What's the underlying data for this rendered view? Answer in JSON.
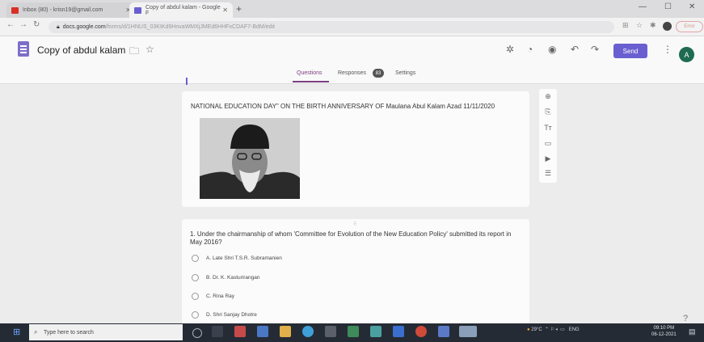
{
  "browser": {
    "tabs": [
      {
        "label": "Inbox (80) - krisn19@gmail.com",
        "favicon_color": "#d93025"
      },
      {
        "label": "Copy of abdul kalam - Google F",
        "favicon_color": "#6a5fd0"
      }
    ],
    "url_domain": "docs.google.com",
    "url_path": "/forms/d/1HNUS_03KIKd9HnvaWMXjJMEd6HHFxCDAF7-BdM/edit",
    "profile_label": "Error"
  },
  "form": {
    "doc_title": "Copy of abdul kalam",
    "send_label": "Send",
    "avatar_initial": "A",
    "tabs": {
      "questions": "Questions",
      "responses": "Responses",
      "responses_count": "83",
      "settings": "Settings"
    },
    "title": "NATIONAL EDUCATION DAY\" ON THE BIRTH ANNIVERSARY OF Maulana Abul Kalam Azad 11/11/2020",
    "question": {
      "text": "1. Under the chairmanship of whom 'Committee for Evolution of the New Education Policy' submitted its report in May 2016?",
      "options": [
        "A. Late Shri T.S.R. Subramanien",
        "B. Dr. K. Kasturirangan",
        "C. Rina Ray",
        "D. Shri Sanjay Dhotre"
      ]
    },
    "accent_color": "#6a5fd0"
  },
  "taskbar": {
    "search_placeholder": "Type here to search",
    "temperature": "29°C",
    "language": "ENG",
    "time": "09:10 PM",
    "date": "06-12-2021"
  }
}
